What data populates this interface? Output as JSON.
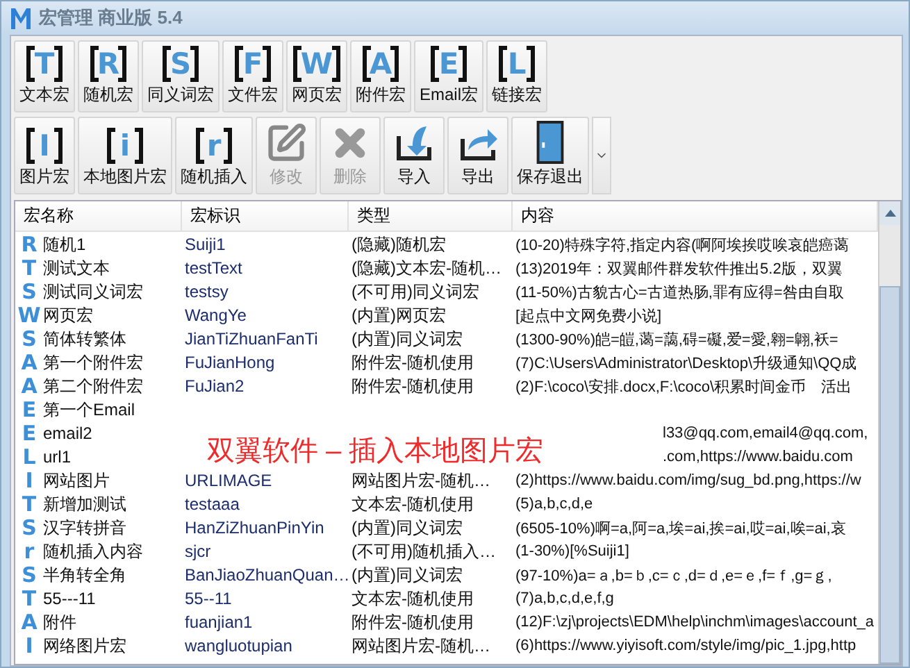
{
  "window": {
    "title": "宏管理 商业版 5.4"
  },
  "toolbar_rows": [
    [
      {
        "kind": "letter",
        "letter": "T",
        "label": "文本宏",
        "disabled": false
      },
      {
        "kind": "letter",
        "letter": "R",
        "label": "随机宏",
        "disabled": false
      },
      {
        "kind": "letter",
        "letter": "S",
        "label": "同义词宏",
        "disabled": false
      },
      {
        "kind": "letter",
        "letter": "F",
        "label": "文件宏",
        "disabled": false
      },
      {
        "kind": "letter",
        "letter": "W",
        "label": "网页宏",
        "disabled": false
      },
      {
        "kind": "letter",
        "letter": "A",
        "label": "附件宏",
        "disabled": false
      },
      {
        "kind": "letter",
        "letter": "E",
        "label": "Email宏",
        "disabled": false
      },
      {
        "kind": "letter",
        "letter": "L",
        "label": "链接宏",
        "disabled": false
      }
    ],
    [
      {
        "kind": "letter",
        "letter": "I",
        "label": "图片宏",
        "disabled": false
      },
      {
        "kind": "letter",
        "letter": "i",
        "label": "本地图片宏",
        "disabled": false
      },
      {
        "kind": "letter",
        "letter": "r",
        "label": "随机插入",
        "disabled": false
      },
      {
        "kind": "edit",
        "label": "修改",
        "disabled": true
      },
      {
        "kind": "delete",
        "label": "删除",
        "disabled": true
      },
      {
        "kind": "import",
        "label": "导入",
        "disabled": false
      },
      {
        "kind": "export",
        "label": "导出",
        "disabled": false
      },
      {
        "kind": "exit",
        "label": "保存退出",
        "disabled": false
      },
      {
        "kind": "more"
      }
    ]
  ],
  "table": {
    "columns": [
      "宏名称",
      "宏标识",
      "类型",
      "内容"
    ],
    "rows": [
      {
        "mark": "R",
        "name": "随机1",
        "id": "Suiji1",
        "type": "(隐藏)随机宏",
        "content": "(10-20)特殊字符,指定内容(啊阿埃挨哎唉哀皑癌蔼"
      },
      {
        "mark": "T",
        "name": "测试文本",
        "id": "testText",
        "type": "(隐藏)文本宏-随机…",
        "content": "(13)2019年：双翼邮件群发软件推出5.2版，双翼"
      },
      {
        "mark": "S",
        "name": "测试同义词宏",
        "id": "testsy",
        "type": "(不可用)同义词宏",
        "content": "(11-50%)古貌古心=古道热肠,罪有应得=咎由自取"
      },
      {
        "mark": "W",
        "name": "网页宏",
        "id": "WangYe",
        "type": "(内置)网页宏",
        "content": "[起点中文网免费小说]"
      },
      {
        "mark": "S",
        "name": "简体转繁体",
        "id": "JianTiZhuanFanTi",
        "type": "(内置)同义词宏",
        "content": "(1300-90%)皑=皚,蔼=藹,碍=礙,爱=愛,翱=翺,袄="
      },
      {
        "mark": "A",
        "name": "第一个附件宏",
        "id": "FuJianHong",
        "type": "附件宏-随机使用",
        "content": "(7)C:\\Users\\Administrator\\Desktop\\升级通知\\QQ成"
      },
      {
        "mark": "A",
        "name": "第二个附件宏",
        "id": "FuJian2",
        "type": "附件宏-随机使用",
        "content": "(2)F:\\coco\\安排.docx,F:\\coco\\积累时间金币　活出"
      },
      {
        "mark": "E",
        "name": "第一个Email"
      },
      {
        "mark": "E",
        "name": "email2",
        "content": "l33@qq.com,email4@qq.com,"
      },
      {
        "mark": "L",
        "name": "url1",
        "content": ".com,https://www.baidu.com"
      },
      {
        "mark": "I",
        "name": "网站图片",
        "id": "URLIMAGE",
        "type": "网站图片宏-随机…",
        "content": "(2)https://www.baidu.com/img/sug_bd.png,https://w"
      },
      {
        "mark": "T",
        "name": "新增加测试",
        "id": "testaaa",
        "type": "文本宏-随机使用",
        "content": "(5)a,b,c,d,e"
      },
      {
        "mark": "S",
        "name": "汉字转拼音",
        "id": "HanZiZhuanPinYin",
        "type": "(内置)同义词宏",
        "content": "(6505-10%)啊=a,阿=a,埃=ai,挨=ai,哎=ai,唉=ai,哀"
      },
      {
        "mark": "r",
        "name": "随机插入内容",
        "id": "sjcr",
        "type": "(不可用)随机插入…",
        "content": "(1-30%)[%Suiji1]"
      },
      {
        "mark": "S",
        "name": "半角转全角",
        "id": "BanJiaoZhuanQuan…",
        "type": "(内置)同义词宏",
        "content": "(97-10%)a=ａ,b=ｂ,c=ｃ,d=ｄ,e=ｅ,f=ｆ,g=ｇ,"
      },
      {
        "mark": "T",
        "name": "55---11",
        "id": "55--11",
        "type": "文本宏-随机使用",
        "content": "(7)a,b,c,d,e,f,g"
      },
      {
        "mark": "A",
        "name": "附件",
        "id": "fuanjian1",
        "type": "附件宏-随机使用",
        "content": "(12)F:\\zj\\projects\\EDM\\help\\inchm\\images\\account_a"
      },
      {
        "mark": "I",
        "name": "网络图片宏",
        "id": "wangluotupian",
        "type": "网站图片宏-随机…",
        "content": "(6)https://www.yiyisoft.com/style/img/pic_1.jpg,http"
      }
    ]
  },
  "caption": "双翼软件 – 插入本地图片宏"
}
